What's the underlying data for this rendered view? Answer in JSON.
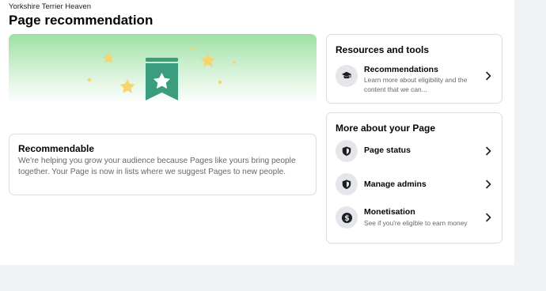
{
  "page": {
    "name": "Yorkshire Terrier Heaven",
    "title": "Page recommendation"
  },
  "recommendable": {
    "title": "Recommendable",
    "description": "We're helping you grow your audience because Pages like yours bring people together. Your Page is now in lists where we suggest Pages to new people."
  },
  "resources": {
    "title": "Resources and tools",
    "items": [
      {
        "label": "Recommendations",
        "description": "Learn more about eligibility and the content that we can...",
        "icon": "graduation-cap-icon"
      }
    ]
  },
  "more": {
    "title": "More about your Page",
    "items": [
      {
        "label": "Page status",
        "icon": "shield-icon"
      },
      {
        "label": "Manage admins",
        "icon": "shield-icon"
      },
      {
        "label": "Monetisation",
        "description": "See if you're eligible to earn money",
        "icon": "dollar-icon"
      }
    ]
  },
  "colors": {
    "hero_green": "#9ee0a4",
    "badge_green": "#3a9e7e",
    "star_yellow": "#f5d66e",
    "text_secondary": "#65676b",
    "border": "#dadde1"
  }
}
